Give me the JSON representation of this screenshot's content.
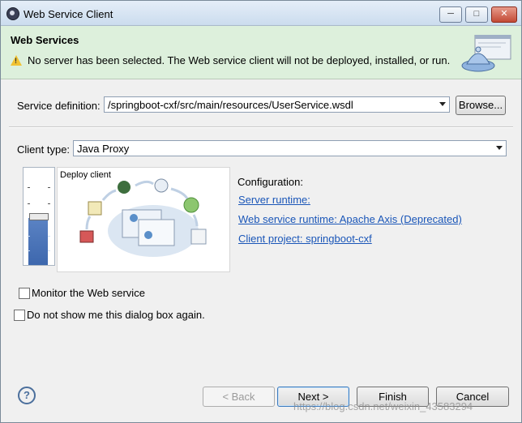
{
  "window": {
    "title": "Web Service Client",
    "min_label": "─",
    "max_label": "□",
    "close_label": "✕"
  },
  "header": {
    "title": "Web Services",
    "message": "No server has been selected. The Web service client will not be deployed, installed, or run."
  },
  "service_definition": {
    "label": "Service definition:",
    "value": "/springboot-cxf/src/main/resources/UserService.wsdl",
    "browse_label": "Browse..."
  },
  "client_type": {
    "label": "Client type:",
    "value": "Java Proxy"
  },
  "slider": {
    "level_label": "Deploy client",
    "level_fraction": 0.45
  },
  "configuration": {
    "title": "Configuration:",
    "server_runtime": "Server runtime: ",
    "web_service_runtime": "Web service runtime: Apache Axis (Deprecated)",
    "client_project": "Client project: springboot-cxf"
  },
  "options": {
    "monitor": "Monitor the Web service",
    "do_not_show": "Do not show me this dialog box again."
  },
  "buttons": {
    "back": "< Back",
    "next": "Next >",
    "finish": "Finish",
    "cancel": "Cancel"
  },
  "watermark": "https://blog.csdn.net/weixin_43583294",
  "colors": {
    "header_bg": "#ddf0dc",
    "link": "#1a56b8",
    "slider_fill": "#3d67ad"
  }
}
